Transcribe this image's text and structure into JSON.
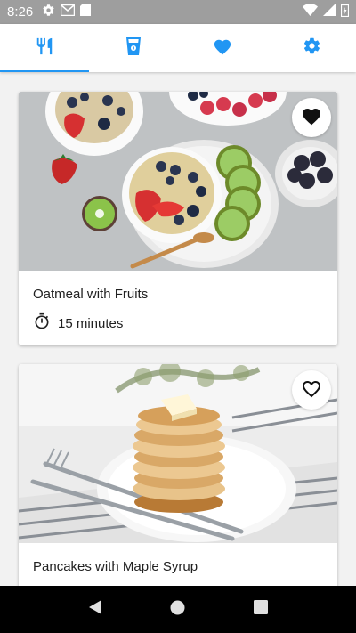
{
  "status_bar": {
    "time": "8:26",
    "icons": [
      "gear-icon",
      "gmail-icon",
      "sd-card-icon",
      "wifi-icon",
      "signal-icon",
      "battery-charging-icon"
    ]
  },
  "tabs": [
    {
      "name": "meals",
      "icon": "fork-knife-icon",
      "active": true
    },
    {
      "name": "drinks",
      "icon": "cup-icon",
      "active": false
    },
    {
      "name": "favorites",
      "icon": "heart-icon",
      "active": false
    },
    {
      "name": "settings",
      "icon": "gear-icon",
      "active": false
    }
  ],
  "colors": {
    "accent": "#2196f3",
    "status_bar": "#9e9e9e",
    "nav_bar": "#000000"
  },
  "recipes": [
    {
      "title": "Oatmeal with Fruits",
      "time": "15 minutes",
      "favorite": true,
      "image": "oatmeal-fruits-photo"
    },
    {
      "title": "Pancakes with Maple Syrup",
      "time": "",
      "favorite": false,
      "image": "pancakes-photo"
    }
  ],
  "system_nav": [
    "back-icon",
    "home-icon",
    "recents-icon"
  ]
}
